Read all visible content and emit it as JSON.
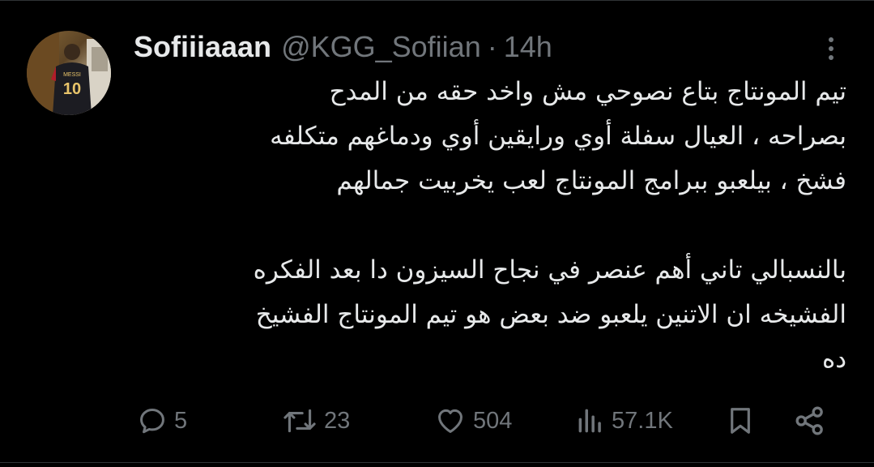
{
  "tweet": {
    "author_name": "Sofiiiaaan",
    "handle": "@KGG_Sofiian",
    "separator": "·",
    "time": "14h",
    "avatar_jersey_name": "MESSI",
    "avatar_jersey_number": "10",
    "text_lines_p1": [
      "تيم المونتاج بتاع نصوحي مش واخد حقه من المدح",
      "بصراحه ، العيال سفلة أوي ورايقين أوي ودماغهم متكلفه",
      "فشخ ، بيلعبو ببرامج المونتاج لعب يخربيت جمالهم"
    ],
    "text_lines_p2": [
      "بالنسبالي تاني أهم عنصر في نجاح السيزون دا بعد الفكره",
      "الفشيخه ان الاتنين يلعبو ضد بعض هو تيم المونتاج الفشيخ",
      "ده"
    ]
  },
  "actions": {
    "replies": "5",
    "retweets": "23",
    "likes": "504",
    "views": "57.1K"
  },
  "icons": {
    "reply": "reply-icon",
    "retweet": "retweet-icon",
    "like": "heart-icon",
    "views": "views-icon",
    "bookmark": "bookmark-icon",
    "share": "share-icon",
    "more": "more-icon"
  },
  "colors": {
    "background": "#000000",
    "text": "#e7e9ea",
    "secondary": "#71767b"
  }
}
